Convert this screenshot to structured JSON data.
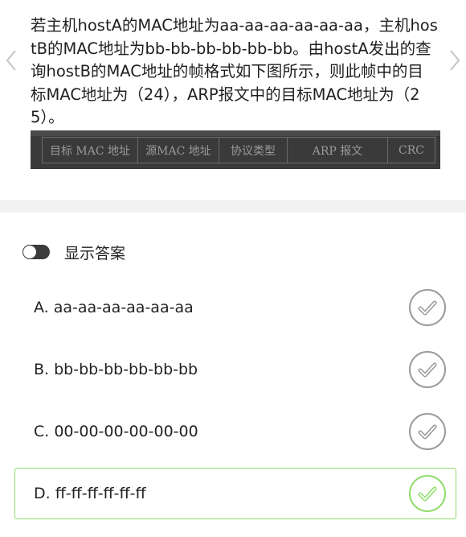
{
  "question": {
    "text": "若主机hostA的MAC地址为aa-aa-aa-aa-aa-aa，主机hostB的MAC地址为bb-bb-bb-bb-bb-bb。由hostA发出的查询hostB的MAC地址的帧格式如下图所示，则此帧中的目标MAC地址为（24），ARP报文中的目标MAC地址为（25）。"
  },
  "figure": {
    "fields": [
      "目标 MAC 地址",
      "源MAC 地址",
      "协议类型",
      "ARP 报文",
      "CRC"
    ]
  },
  "answer_toggle": {
    "label": "显示答案",
    "on": false
  },
  "options": [
    {
      "label": "A. aa-aa-aa-aa-aa-aa",
      "selected": false
    },
    {
      "label": "B. bb-bb-bb-bb-bb-bb",
      "selected": false
    },
    {
      "label": "C. 00-00-00-00-00-00",
      "selected": false
    },
    {
      "label": "D. ff-ff-ff-ff-ff-ff",
      "selected": true
    }
  ],
  "colors": {
    "selected": "#8fdc6a",
    "unselected": "#9a9a9a",
    "toggle_off": "#3c3c3c"
  }
}
